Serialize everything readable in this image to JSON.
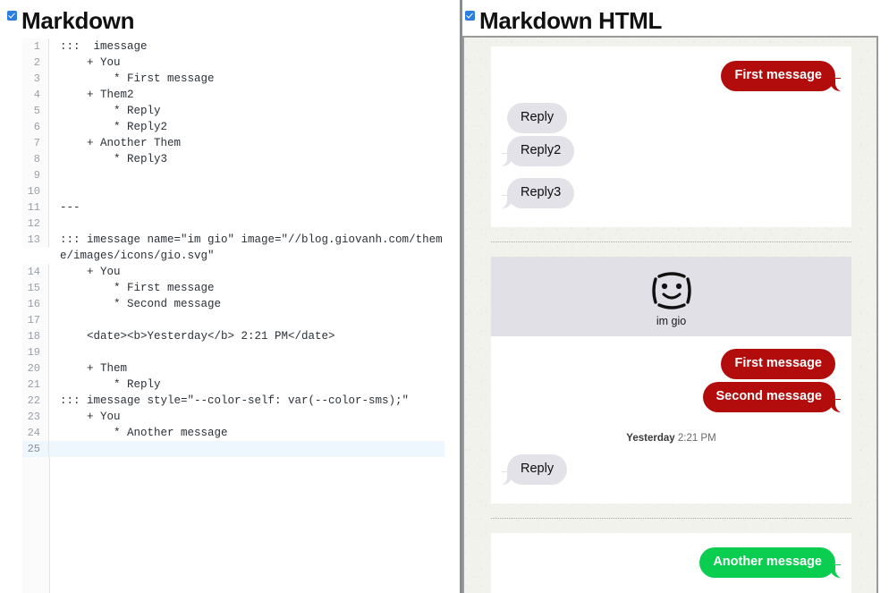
{
  "left": {
    "checkbox_checked": true,
    "title": "Markdown",
    "accent": "#2a7fe0",
    "active_line": 25,
    "lines": [
      {
        "n": "1",
        "text": ":::  imessage"
      },
      {
        "n": "2",
        "text": "    + You"
      },
      {
        "n": "3",
        "text": "        * First message"
      },
      {
        "n": "4",
        "text": "    + Them2"
      },
      {
        "n": "5",
        "text": "        * Reply"
      },
      {
        "n": "6",
        "text": "        * Reply2"
      },
      {
        "n": "7",
        "text": "    + Another Them"
      },
      {
        "n": "8",
        "text": "        * Reply3"
      },
      {
        "n": "9",
        "text": ""
      },
      {
        "n": "10",
        "text": ""
      },
      {
        "n": "11",
        "text": "---"
      },
      {
        "n": "12",
        "text": ""
      },
      {
        "n": "13",
        "text": "::: imessage name=\"im gio\" image=\"//blog.giovanh.com/theme/images/icons/gio.svg\""
      },
      {
        "n": "14",
        "text": "    + You"
      },
      {
        "n": "15",
        "text": "        * First message"
      },
      {
        "n": "16",
        "text": "        * Second message"
      },
      {
        "n": "17",
        "text": ""
      },
      {
        "n": "18",
        "text": "    <date><b>Yesterday</b> 2:21 PM</date>"
      },
      {
        "n": "19",
        "text": ""
      },
      {
        "n": "20",
        "text": "    + Them"
      },
      {
        "n": "21",
        "text": "        * Reply"
      },
      {
        "n": "22",
        "text": "::: imessage style=\"--color-self: var(--color-sms);\""
      },
      {
        "n": "23",
        "text": "    + You"
      },
      {
        "n": "24",
        "text": "        * Another message"
      },
      {
        "n": "25",
        "text": ""
      }
    ]
  },
  "right": {
    "checkbox_checked": true,
    "title": "Markdown HTML",
    "colors": {
      "self_imessage": "#b20c0c",
      "self_sms": "#0bcd4f",
      "them": "#e3e2e9",
      "page_cream": "#f2f2ec",
      "divider": "#b3a98c"
    },
    "conversations": [
      {
        "name": "",
        "avatar": null,
        "self_color": "#b20c0c",
        "groups": [
          {
            "side": "self",
            "speaker": "You",
            "messages": [
              "First message"
            ]
          },
          {
            "side": "them",
            "speaker": "Them2",
            "messages": [
              "Reply",
              "Reply2"
            ]
          },
          {
            "side": "them",
            "speaker": "Another Them",
            "messages": [
              "Reply3"
            ]
          }
        ]
      },
      {
        "name": "im gio",
        "avatar": "smiley-face-icon",
        "self_color": "#b20c0c",
        "groups": [
          {
            "side": "self",
            "speaker": "You",
            "messages": [
              "First message",
              "Second message"
            ]
          },
          {
            "side": "date",
            "date_bold": "Yesterday",
            "date_rest": " 2:21 PM"
          },
          {
            "side": "them",
            "speaker": "Them",
            "messages": [
              "Reply"
            ]
          }
        ]
      },
      {
        "name": "",
        "avatar": null,
        "self_color": "#0bcd4f",
        "groups": [
          {
            "side": "self",
            "speaker": "You",
            "messages": [
              "Another message"
            ]
          }
        ]
      }
    ]
  }
}
